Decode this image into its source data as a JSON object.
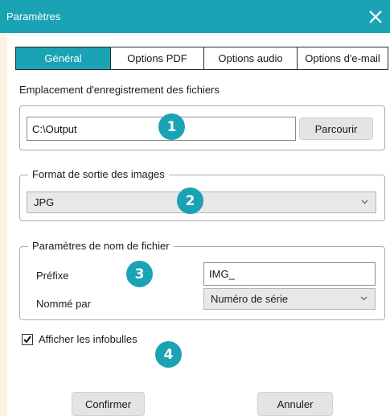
{
  "window": {
    "title": "Paramètres"
  },
  "tabs": [
    {
      "label": "Général",
      "active": true
    },
    {
      "label": "Options PDF",
      "active": false
    },
    {
      "label": "Options audio",
      "active": false
    },
    {
      "label": "Options d'e-mail",
      "active": false
    }
  ],
  "save_location": {
    "label": "Emplacement d'enregistrement des fichiers",
    "path_value": "C:\\Output",
    "browse_label": "Parcourir"
  },
  "image_format": {
    "legend": "Format de sortie des images",
    "selected": "JPG"
  },
  "naming": {
    "legend": "Paramètres de nom de fichier",
    "prefix_label": "Préfixe",
    "prefix_value": "IMG_",
    "named_by_label": "Nommé par",
    "named_by_selected": "Numéro de série"
  },
  "tooltips": {
    "label": "Afficher les infobulles",
    "checked": true
  },
  "badges": [
    "1",
    "2",
    "3",
    "4"
  ],
  "footer": {
    "confirm_label": "Confirmer",
    "cancel_label": "Annuler"
  },
  "colors": {
    "accent": "#1aa3b5",
    "side_strip": "#fbf3e4",
    "button_bg": "#e4e4e4"
  }
}
